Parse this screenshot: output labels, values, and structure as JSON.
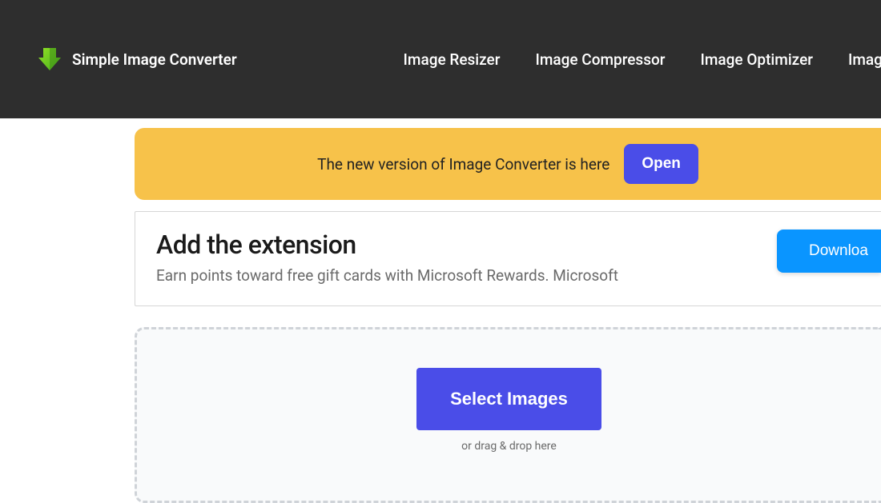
{
  "brand": {
    "title": "Simple Image Converter"
  },
  "nav": {
    "items": [
      "Image Resizer",
      "Image Compressor",
      "Image Optimizer",
      "Image Conv"
    ]
  },
  "banner": {
    "text": "The new version of Image Converter is here",
    "button": "Open"
  },
  "promo": {
    "title": "Add the extension",
    "subtitle": "Earn points toward free gift cards with Microsoft Rewards. Microsoft",
    "button": "Downloa"
  },
  "dropzone": {
    "button": "Select Images",
    "hint": "or drag & drop here"
  }
}
